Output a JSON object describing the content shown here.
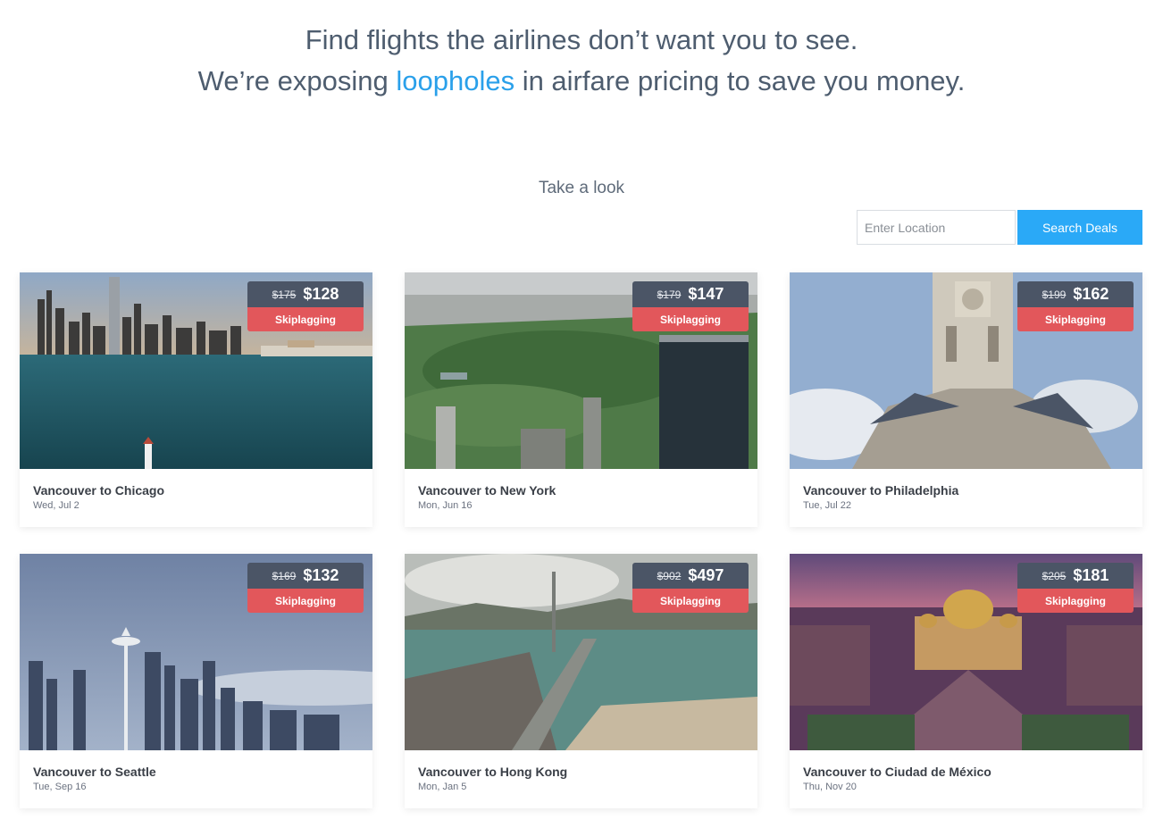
{
  "hero": {
    "line1": "Find flights the airlines don’t want you to see.",
    "line2_before": "We’re exposing ",
    "line2_accent": "loopholes",
    "line2_after": " in airfare pricing to save you money."
  },
  "take_look": "Take a look",
  "search": {
    "placeholder": "Enter Location",
    "button": "Search Deals"
  },
  "colors": {
    "accent": "#2aa0ea",
    "button": "#2aa9f7",
    "badge_dark": "#4b5566",
    "badge_red": "#e2575b"
  },
  "deals": [
    {
      "route": "Vancouver to Chicago",
      "date": "Wed, Jul 2",
      "old_price": "$175",
      "price": "$128",
      "tag": "Skiplagging",
      "image": "chicago-skyline-harbor"
    },
    {
      "route": "Vancouver to New York",
      "date": "Mon, Jun 16",
      "old_price": "$179",
      "price": "$147",
      "tag": "Skiplagging",
      "image": "central-park-aerial"
    },
    {
      "route": "Vancouver to Philadelphia",
      "date": "Tue, Jul 22",
      "old_price": "$199",
      "price": "$162",
      "tag": "Skiplagging",
      "image": "philadelphia-city-hall"
    },
    {
      "route": "Vancouver to Seattle",
      "date": "Tue, Sep 16",
      "old_price": "$169",
      "price": "$132",
      "tag": "Skiplagging",
      "image": "seattle-space-needle"
    },
    {
      "route": "Vancouver to Hong Kong",
      "date": "Mon, Jan 5",
      "old_price": "$902",
      "price": "$497",
      "tag": "Skiplagging",
      "image": "hong-kong-bridge-harbor"
    },
    {
      "route": "Vancouver to Ciudad de México",
      "date": "Thu, Nov 20",
      "old_price": "$205",
      "price": "$181",
      "tag": "Skiplagging",
      "image": "palacio-bellas-artes"
    }
  ]
}
